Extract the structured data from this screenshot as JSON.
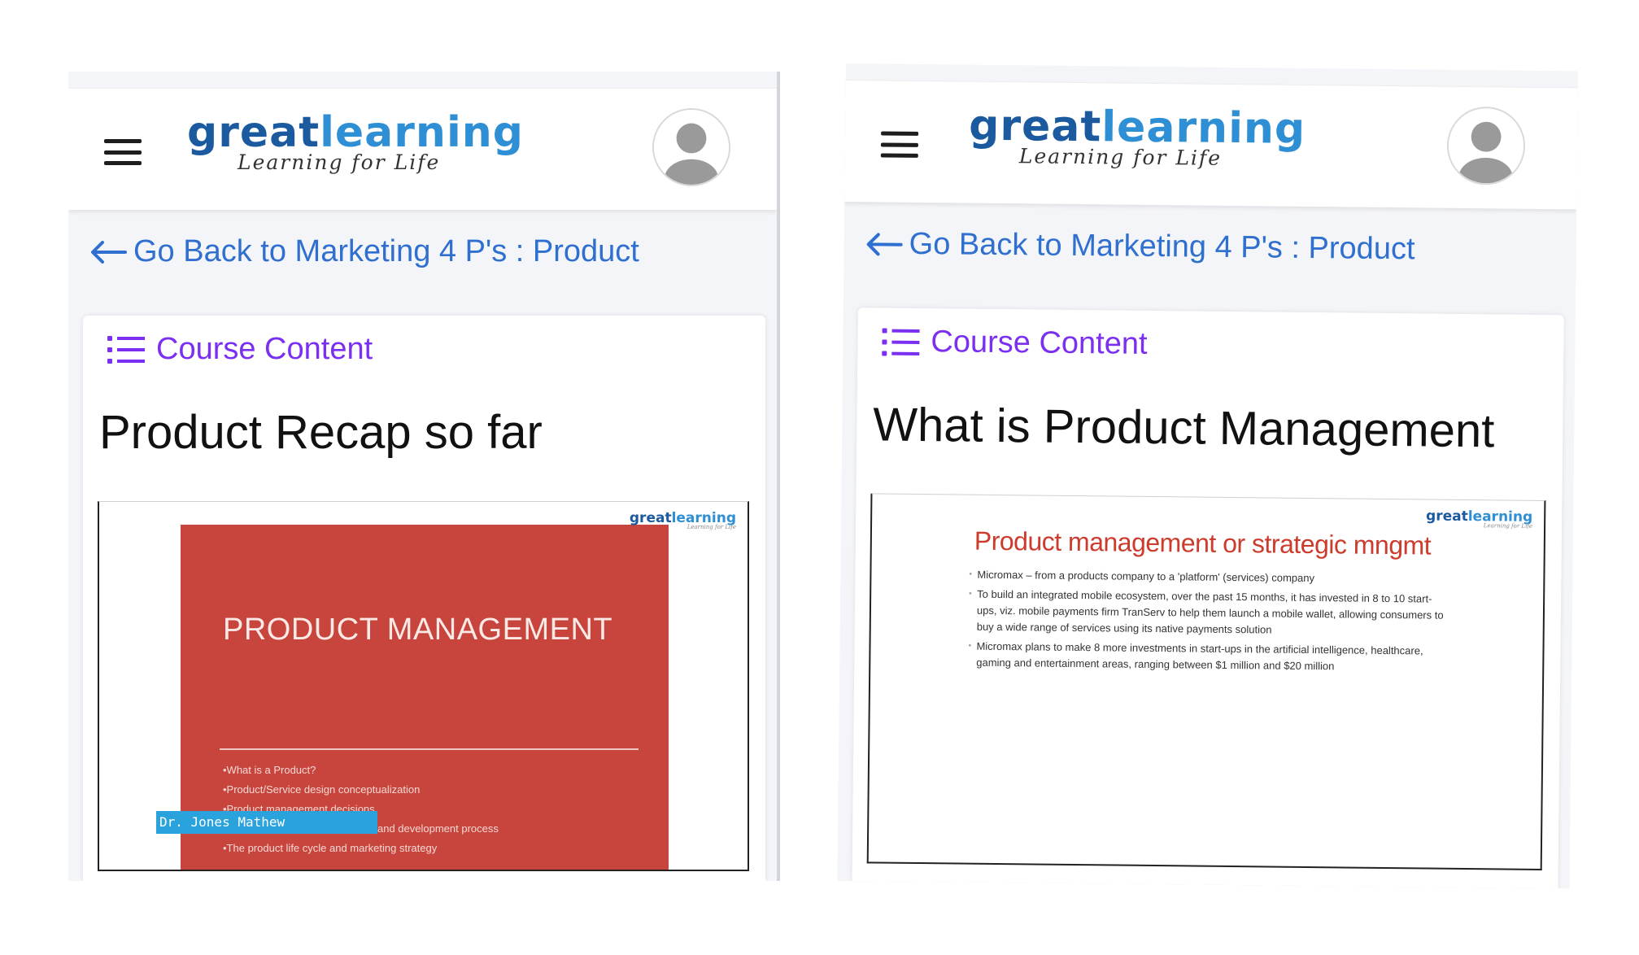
{
  "logo": {
    "great": "great",
    "learning": "learning",
    "tagline": "Learning for Life"
  },
  "colors": {
    "logo_dark": "#1b5a9e",
    "logo_light": "#2e8fd5",
    "link_blue": "#2f6fcf",
    "accent_purple": "#7b2ff0",
    "slide_red": "#c8453d",
    "caption_blue": "#2aa3dd"
  },
  "icons": {
    "menu": "hamburger-icon",
    "profile": "avatar-icon",
    "back": "arrow-left-icon",
    "content": "list-icon"
  },
  "screens": [
    {
      "back_link": "Go Back to Marketing 4 P's : Product",
      "course_content": "Course Content",
      "lesson_title": "Product Recap so far",
      "slide": {
        "title": "PRODUCT MANAGEMENT",
        "bullets": [
          "•What is a Product?",
          "•Product/Service design conceptualization",
          "•Product management decisions",
          "and development process",
          "•The product life cycle and marketing strategy"
        ],
        "caption": "Dr. Jones Mathew"
      }
    },
    {
      "back_link": "Go Back to Marketing 4 P's : Product",
      "course_content": "Course Content",
      "lesson_title": "What is Product Management",
      "slide": {
        "title": "Product management or strategic mngmt",
        "bullets": [
          "Micromax – from a products company to a 'platform' (services) company",
          "To build an integrated mobile ecosystem, over the past 15 months, it has invested in 8 to 10 start-ups, viz. mobile payments firm TranServ to help them launch a mobile wallet, allowing consumers to buy a wide range of services using its native payments solution",
          "Micromax plans to make 8 more investments in start-ups in the artificial intelligence, healthcare, gaming and entertainment areas, ranging between $1 million and $20 million"
        ]
      }
    }
  ]
}
